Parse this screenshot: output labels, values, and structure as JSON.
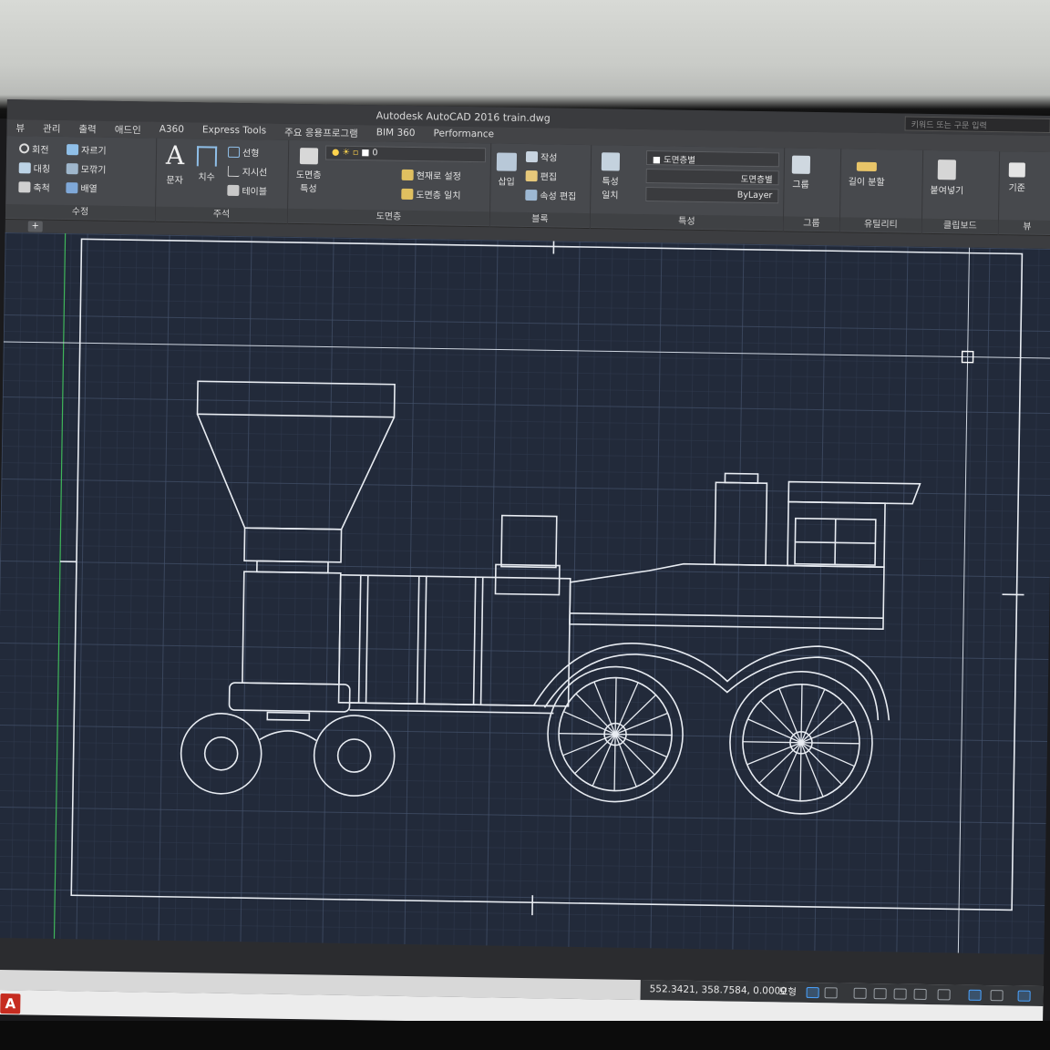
{
  "window": {
    "title": "Autodesk AutoCAD 2016    train.dwg",
    "search_placeholder": "키워드 또는 구문 입력"
  },
  "tabs": [
    "뷰",
    "관리",
    "출력",
    "애드인",
    "A360",
    "Express Tools",
    "주요 응용프로그램",
    "BIM 360",
    "Performance"
  ],
  "ribbon": {
    "modify": {
      "label": "수정",
      "rotate": "회전",
      "trim": "자르기",
      "mirror": "대칭",
      "fillet": "모깎기",
      "scale": "축척",
      "array": "배열"
    },
    "annotation": {
      "label": "주석",
      "text": "문자",
      "dimension": "치수",
      "linear": "선형",
      "leader": "지시선",
      "table": "테이블"
    },
    "layers": {
      "label": "도면층",
      "layer_properties": "도면층 특성",
      "layer_value": "0",
      "set_current": "현재로 설정",
      "match_layer": "도면층 일치"
    },
    "block": {
      "label": "블록",
      "insert": "삽입",
      "create": "작성",
      "edit": "편집",
      "edit_attributes": "속성 편집"
    },
    "properties": {
      "label": "특성",
      "match_properties": "특성 일치",
      "color_value": "도면층별",
      "linetype_value": "도면층별",
      "lineweight_value": "ByLayer"
    },
    "groups": {
      "label": "그룹",
      "group": "그룹"
    },
    "utilities": {
      "label": "유틸리티",
      "measure": "길이 분할"
    },
    "clipboard": {
      "label": "클립보드",
      "paste": "붙여넣기"
    },
    "view": {
      "label": "뷰",
      "base": "기준"
    }
  },
  "filetab_plus": "+",
  "status": {
    "coordinates": "552.3421, 358.7584, 0.0000",
    "model": "모형"
  },
  "logo": "A"
}
